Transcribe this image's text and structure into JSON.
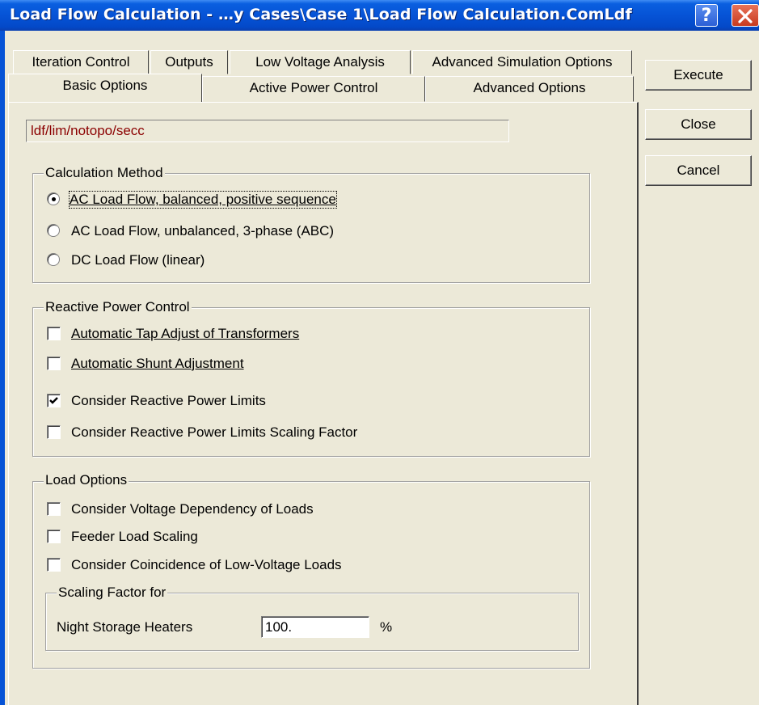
{
  "window": {
    "title": "Load Flow Calculation - …y Cases\\Case 1\\Load Flow Calculation.ComLdf",
    "help_glyph": "?",
    "title_color": "#0653d6"
  },
  "tabs": {
    "row1": [
      "Iteration Control",
      "Outputs",
      "Low Voltage Analysis",
      "Advanced Simulation Options"
    ],
    "row2": [
      "Basic Options",
      "Active Power Control",
      "Advanced Options"
    ],
    "active": "Basic Options"
  },
  "buttons": {
    "execute": "Execute",
    "close": "Close",
    "cancel": "Cancel"
  },
  "path": "ldf/lim/notopo/secc",
  "calculation_method": {
    "title": "Calculation Method",
    "options": [
      "AC Load Flow, balanced, positive sequence",
      "AC Load Flow, unbalanced, 3-phase (ABC)",
      "DC Load Flow (linear)"
    ],
    "selected": 0
  },
  "reactive_power_control": {
    "title": "Reactive Power Control",
    "options": [
      {
        "label": "Automatic Tap Adjust of Transformers",
        "checked": false
      },
      {
        "label": "Automatic Shunt Adjustment",
        "checked": false
      },
      {
        "label": "Consider Reactive Power Limits",
        "checked": true
      },
      {
        "label": "Consider Reactive Power Limits Scaling Factor",
        "checked": false
      }
    ]
  },
  "load_options": {
    "title": "Load Options",
    "options": [
      {
        "label": "Consider Voltage Dependency of Loads",
        "checked": false
      },
      {
        "label": "Feeder Load Scaling",
        "checked": false
      },
      {
        "label": "Consider Coincidence of Low-Voltage Loads",
        "checked": false
      }
    ],
    "scaling": {
      "title": "Scaling Factor for",
      "label": "Night Storage Heaters",
      "value": "100.",
      "unit": "%"
    }
  }
}
